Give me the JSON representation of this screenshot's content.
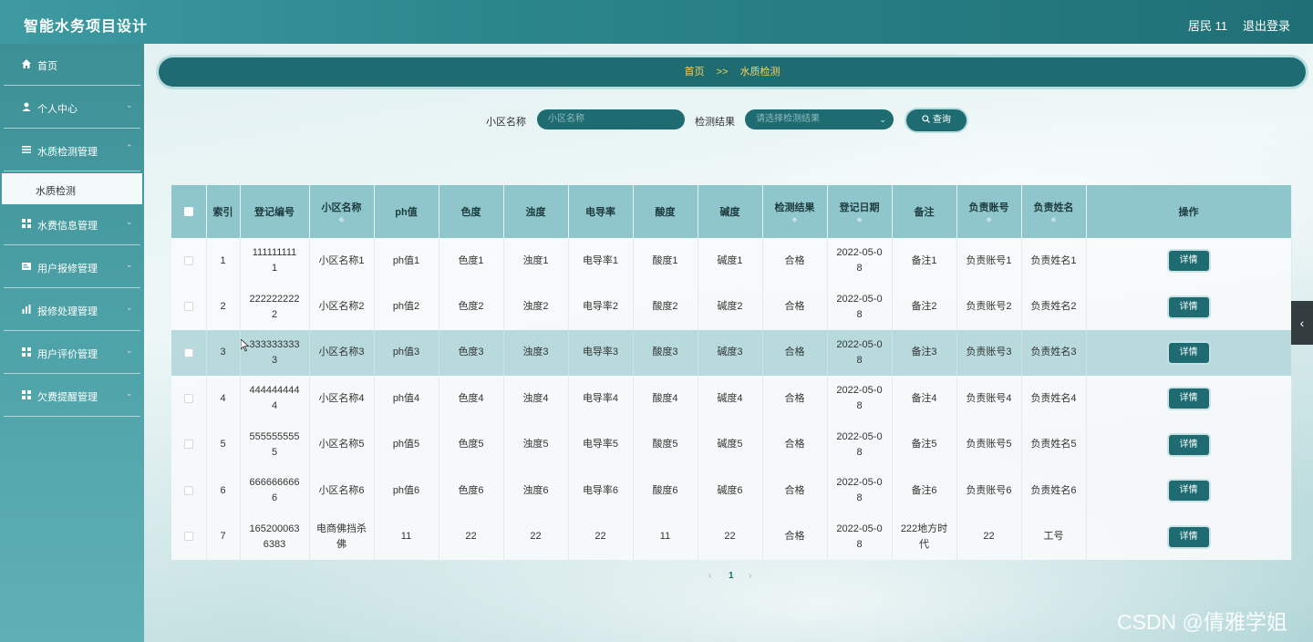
{
  "app": {
    "title": "智能水务项目设计"
  },
  "top": {
    "user": "居民 11",
    "logout": "退出登录"
  },
  "sidebar": {
    "items": [
      {
        "label": "首页",
        "icon": "home-icon"
      },
      {
        "label": "个人中心",
        "icon": "user-icon"
      },
      {
        "label": "水质检测管理",
        "icon": "list-icon"
      },
      {
        "label": "水费信息管理",
        "icon": "grid-icon"
      },
      {
        "label": "用户报修管理",
        "icon": "card-icon"
      },
      {
        "label": "报修处理管理",
        "icon": "bar-chart-icon"
      },
      {
        "label": "用户评价管理",
        "icon": "grid-icon"
      },
      {
        "label": "欠费提醒管理",
        "icon": "grid-icon"
      }
    ],
    "sub": "水质检测"
  },
  "breadcrumb": {
    "home": "首页",
    "sep": ">>",
    "current": "水质检测"
  },
  "search": {
    "name_label": "小区名称",
    "name_placeholder": "小区名称",
    "result_label": "检测结果",
    "result_placeholder": "请选择检测结果",
    "query": "查询"
  },
  "table": {
    "headers": [
      "索引",
      "登记编号",
      "小区名称",
      "ph值",
      "色度",
      "浊度",
      "电导率",
      "酸度",
      "碱度",
      "检测结果",
      "登记日期",
      "备注",
      "负责账号",
      "负责姓名",
      "操作"
    ],
    "rows": [
      {
        "index": "1",
        "reg_a": "111111111",
        "reg_b": "1",
        "name": "小区名称1",
        "ph": "ph值1",
        "color": "色度1",
        "turbidity": "浊度1",
        "conductivity": "电导率1",
        "acidity": "酸度1",
        "alkalinity": "碱度1",
        "result": "合格",
        "date_a": "2022-05-0",
        "date_b": "8",
        "remark_a": "备注1",
        "remark_b": "",
        "account": "负责账号1",
        "person": "负责姓名1",
        "action": "详情"
      },
      {
        "index": "2",
        "reg_a": "222222222",
        "reg_b": "2",
        "name": "小区名称2",
        "ph": "ph值2",
        "color": "色度2",
        "turbidity": "浊度2",
        "conductivity": "电导率2",
        "acidity": "酸度2",
        "alkalinity": "碱度2",
        "result": "合格",
        "date_a": "2022-05-0",
        "date_b": "8",
        "remark_a": "备注2",
        "remark_b": "",
        "account": "负责账号2",
        "person": "负责姓名2",
        "action": "详情"
      },
      {
        "index": "3",
        "reg_a": "333333333",
        "reg_b": "3",
        "name": "小区名称3",
        "ph": "ph值3",
        "color": "色度3",
        "turbidity": "浊度3",
        "conductivity": "电导率3",
        "acidity": "酸度3",
        "alkalinity": "碱度3",
        "result": "合格",
        "date_a": "2022-05-0",
        "date_b": "8",
        "remark_a": "备注3",
        "remark_b": "",
        "account": "负责账号3",
        "person": "负责姓名3",
        "action": "详情"
      },
      {
        "index": "4",
        "reg_a": "444444444",
        "reg_b": "4",
        "name": "小区名称4",
        "ph": "ph值4",
        "color": "色度4",
        "turbidity": "浊度4",
        "conductivity": "电导率4",
        "acidity": "酸度4",
        "alkalinity": "碱度4",
        "result": "合格",
        "date_a": "2022-05-0",
        "date_b": "8",
        "remark_a": "备注4",
        "remark_b": "",
        "account": "负责账号4",
        "person": "负责姓名4",
        "action": "详情"
      },
      {
        "index": "5",
        "reg_a": "555555555",
        "reg_b": "5",
        "name": "小区名称5",
        "ph": "ph值5",
        "color": "色度5",
        "turbidity": "浊度5",
        "conductivity": "电导率5",
        "acidity": "酸度5",
        "alkalinity": "碱度5",
        "result": "合格",
        "date_a": "2022-05-0",
        "date_b": "8",
        "remark_a": "备注5",
        "remark_b": "",
        "account": "负责账号5",
        "person": "负责姓名5",
        "action": "详情"
      },
      {
        "index": "6",
        "reg_a": "666666666",
        "reg_b": "6",
        "name": "小区名称6",
        "ph": "ph值6",
        "color": "色度6",
        "turbidity": "浊度6",
        "conductivity": "电导率6",
        "acidity": "酸度6",
        "alkalinity": "碱度6",
        "result": "合格",
        "date_a": "2022-05-0",
        "date_b": "8",
        "remark_a": "备注6",
        "remark_b": "",
        "account": "负责账号6",
        "person": "负责姓名6",
        "action": "详情"
      },
      {
        "index": "7",
        "reg_a": "165200063",
        "reg_b": "6383",
        "name": "电商佛挡杀",
        "name_b": "佛",
        "ph": "11",
        "color": "22",
        "turbidity": "22",
        "conductivity": "22",
        "acidity": "11",
        "alkalinity": "22",
        "result": "合格",
        "date_a": "2022-05-0",
        "date_b": "8",
        "remark_a": "222地方时",
        "remark_b": "代",
        "account": "22",
        "person": "工号",
        "action": "详情"
      }
    ]
  },
  "pagination": {
    "prev": "‹",
    "page": "1",
    "next": "›"
  },
  "watermark": "CSDN @倩雅学姐",
  "colors": {
    "primary": "#1e6c72",
    "accent": "#f5d35c",
    "header_bg": "#8ec6cb"
  }
}
